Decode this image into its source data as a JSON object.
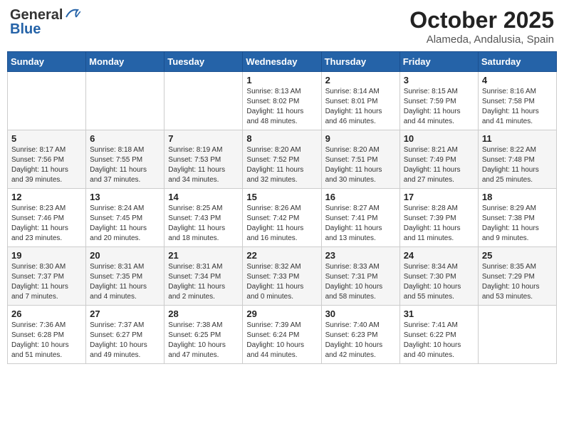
{
  "header": {
    "logo": {
      "general": "General",
      "blue": "Blue"
    },
    "title": "October 2025",
    "location": "Alameda, Andalusia, Spain"
  },
  "days_of_week": [
    "Sunday",
    "Monday",
    "Tuesday",
    "Wednesday",
    "Thursday",
    "Friday",
    "Saturday"
  ],
  "weeks": [
    [
      {
        "day": "",
        "info": ""
      },
      {
        "day": "",
        "info": ""
      },
      {
        "day": "",
        "info": ""
      },
      {
        "day": "1",
        "info": "Sunrise: 8:13 AM\nSunset: 8:02 PM\nDaylight: 11 hours\nand 48 minutes."
      },
      {
        "day": "2",
        "info": "Sunrise: 8:14 AM\nSunset: 8:01 PM\nDaylight: 11 hours\nand 46 minutes."
      },
      {
        "day": "3",
        "info": "Sunrise: 8:15 AM\nSunset: 7:59 PM\nDaylight: 11 hours\nand 44 minutes."
      },
      {
        "day": "4",
        "info": "Sunrise: 8:16 AM\nSunset: 7:58 PM\nDaylight: 11 hours\nand 41 minutes."
      }
    ],
    [
      {
        "day": "5",
        "info": "Sunrise: 8:17 AM\nSunset: 7:56 PM\nDaylight: 11 hours\nand 39 minutes."
      },
      {
        "day": "6",
        "info": "Sunrise: 8:18 AM\nSunset: 7:55 PM\nDaylight: 11 hours\nand 37 minutes."
      },
      {
        "day": "7",
        "info": "Sunrise: 8:19 AM\nSunset: 7:53 PM\nDaylight: 11 hours\nand 34 minutes."
      },
      {
        "day": "8",
        "info": "Sunrise: 8:20 AM\nSunset: 7:52 PM\nDaylight: 11 hours\nand 32 minutes."
      },
      {
        "day": "9",
        "info": "Sunrise: 8:20 AM\nSunset: 7:51 PM\nDaylight: 11 hours\nand 30 minutes."
      },
      {
        "day": "10",
        "info": "Sunrise: 8:21 AM\nSunset: 7:49 PM\nDaylight: 11 hours\nand 27 minutes."
      },
      {
        "day": "11",
        "info": "Sunrise: 8:22 AM\nSunset: 7:48 PM\nDaylight: 11 hours\nand 25 minutes."
      }
    ],
    [
      {
        "day": "12",
        "info": "Sunrise: 8:23 AM\nSunset: 7:46 PM\nDaylight: 11 hours\nand 23 minutes."
      },
      {
        "day": "13",
        "info": "Sunrise: 8:24 AM\nSunset: 7:45 PM\nDaylight: 11 hours\nand 20 minutes."
      },
      {
        "day": "14",
        "info": "Sunrise: 8:25 AM\nSunset: 7:43 PM\nDaylight: 11 hours\nand 18 minutes."
      },
      {
        "day": "15",
        "info": "Sunrise: 8:26 AM\nSunset: 7:42 PM\nDaylight: 11 hours\nand 16 minutes."
      },
      {
        "day": "16",
        "info": "Sunrise: 8:27 AM\nSunset: 7:41 PM\nDaylight: 11 hours\nand 13 minutes."
      },
      {
        "day": "17",
        "info": "Sunrise: 8:28 AM\nSunset: 7:39 PM\nDaylight: 11 hours\nand 11 minutes."
      },
      {
        "day": "18",
        "info": "Sunrise: 8:29 AM\nSunset: 7:38 PM\nDaylight: 11 hours\nand 9 minutes."
      }
    ],
    [
      {
        "day": "19",
        "info": "Sunrise: 8:30 AM\nSunset: 7:37 PM\nDaylight: 11 hours\nand 7 minutes."
      },
      {
        "day": "20",
        "info": "Sunrise: 8:31 AM\nSunset: 7:35 PM\nDaylight: 11 hours\nand 4 minutes."
      },
      {
        "day": "21",
        "info": "Sunrise: 8:31 AM\nSunset: 7:34 PM\nDaylight: 11 hours\nand 2 minutes."
      },
      {
        "day": "22",
        "info": "Sunrise: 8:32 AM\nSunset: 7:33 PM\nDaylight: 11 hours\nand 0 minutes."
      },
      {
        "day": "23",
        "info": "Sunrise: 8:33 AM\nSunset: 7:31 PM\nDaylight: 10 hours\nand 58 minutes."
      },
      {
        "day": "24",
        "info": "Sunrise: 8:34 AM\nSunset: 7:30 PM\nDaylight: 10 hours\nand 55 minutes."
      },
      {
        "day": "25",
        "info": "Sunrise: 8:35 AM\nSunset: 7:29 PM\nDaylight: 10 hours\nand 53 minutes."
      }
    ],
    [
      {
        "day": "26",
        "info": "Sunrise: 7:36 AM\nSunset: 6:28 PM\nDaylight: 10 hours\nand 51 minutes."
      },
      {
        "day": "27",
        "info": "Sunrise: 7:37 AM\nSunset: 6:27 PM\nDaylight: 10 hours\nand 49 minutes."
      },
      {
        "day": "28",
        "info": "Sunrise: 7:38 AM\nSunset: 6:25 PM\nDaylight: 10 hours\nand 47 minutes."
      },
      {
        "day": "29",
        "info": "Sunrise: 7:39 AM\nSunset: 6:24 PM\nDaylight: 10 hours\nand 44 minutes."
      },
      {
        "day": "30",
        "info": "Sunrise: 7:40 AM\nSunset: 6:23 PM\nDaylight: 10 hours\nand 42 minutes."
      },
      {
        "day": "31",
        "info": "Sunrise: 7:41 AM\nSunset: 6:22 PM\nDaylight: 10 hours\nand 40 minutes."
      },
      {
        "day": "",
        "info": ""
      }
    ]
  ]
}
